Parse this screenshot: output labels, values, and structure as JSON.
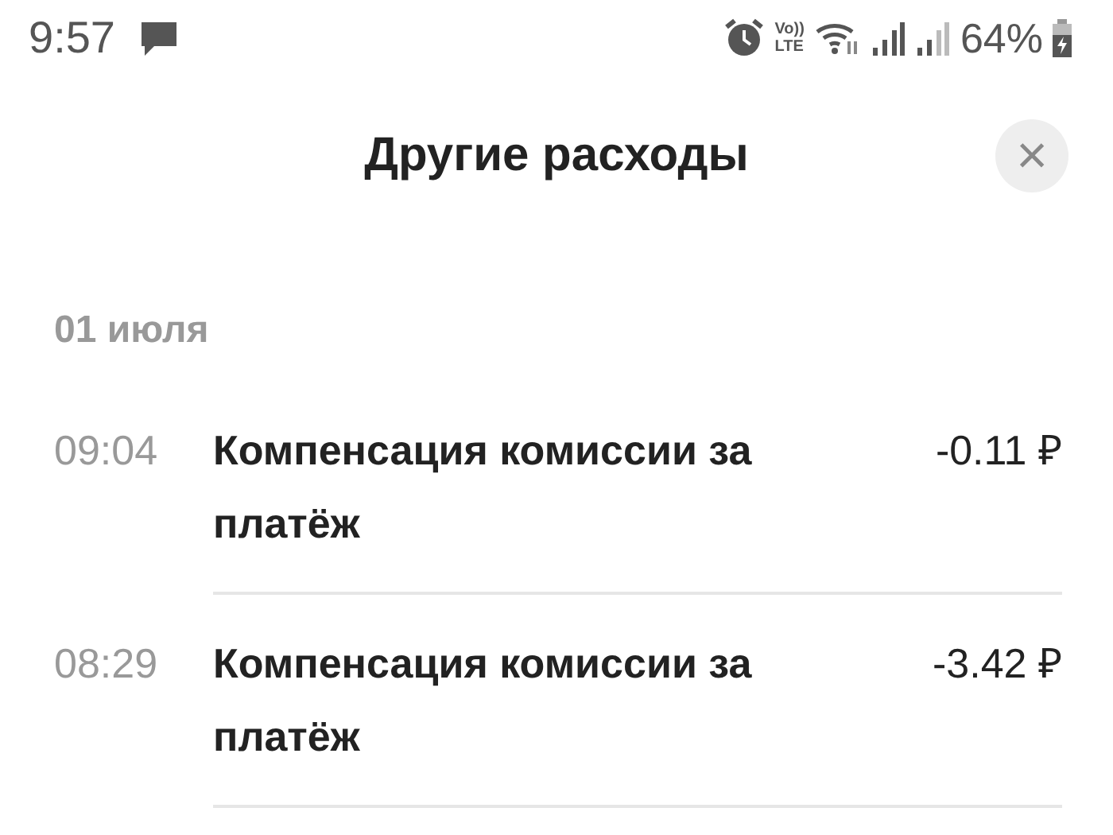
{
  "status_bar": {
    "time": "9:57",
    "volte": [
      "Vo))",
      "LTE"
    ],
    "battery": "64%"
  },
  "header": {
    "title": "Другие расходы",
    "close": "×"
  },
  "groups": [
    {
      "date": "01 июля",
      "items": [
        {
          "time": "09:04",
          "title": "Компенсация комиссии за платёж",
          "amount": "-0.11 ₽"
        },
        {
          "time": "08:29",
          "title": "Компенсация комиссии за платёж",
          "amount": "-3.42 ₽"
        }
      ]
    }
  ]
}
